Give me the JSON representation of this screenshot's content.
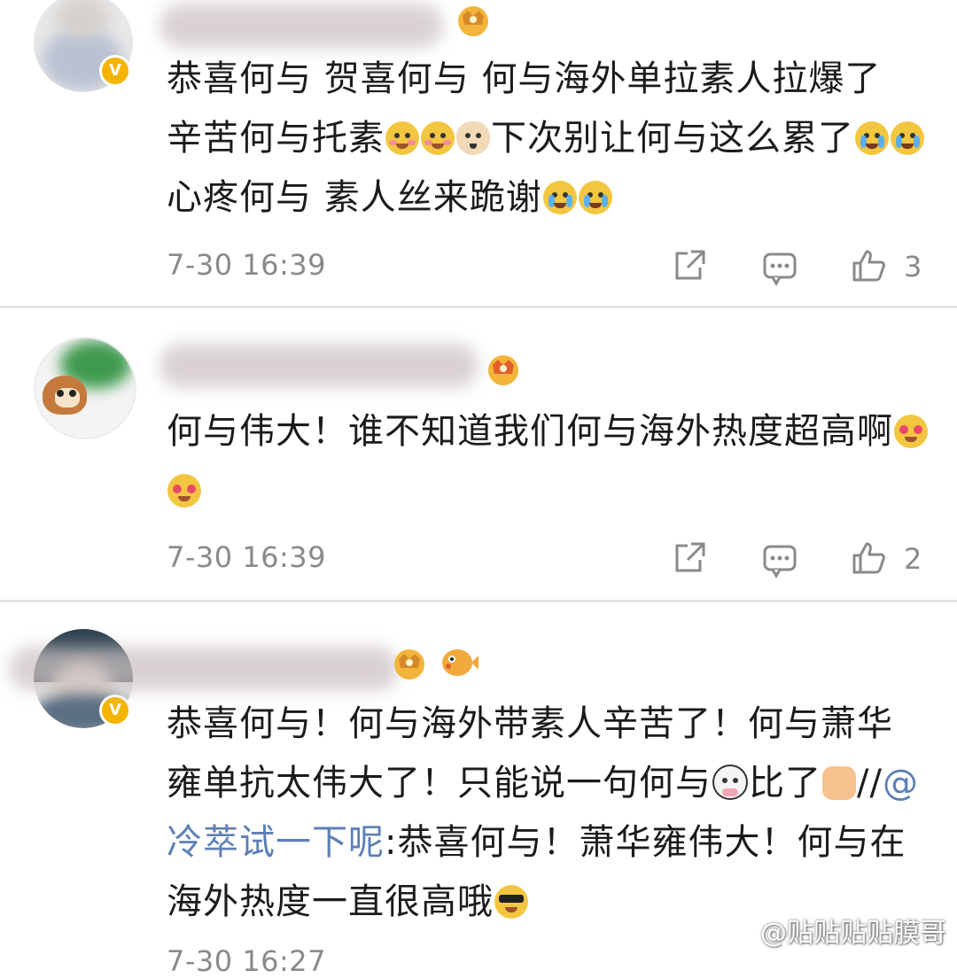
{
  "comments": [
    {
      "text_parts": [
        {
          "t": "text",
          "v": "恭喜何与 贺喜何与 何与海外单拉素人拉爆了 辛苦何与托素"
        },
        {
          "t": "emoji",
          "icon": "blush-face-icon"
        },
        {
          "t": "emoji",
          "icon": "blush-face-icon"
        },
        {
          "t": "emoji",
          "icon": "dog-face-icon"
        },
        {
          "t": "text",
          "v": "下次别让何与这么累了"
        },
        {
          "t": "emoji",
          "icon": "crying-face-icon"
        },
        {
          "t": "emoji",
          "icon": "crying-face-icon"
        },
        {
          "t": "text",
          "v": "心疼何与 素人丝来跪谢"
        },
        {
          "t": "emoji",
          "icon": "crying-face-icon"
        },
        {
          "t": "emoji",
          "icon": "crying-face-icon"
        }
      ],
      "time": "7-30 16:39",
      "likes": "3",
      "badge_icon": "crown-badge-icon",
      "verified": true
    },
    {
      "text_parts": [
        {
          "t": "text",
          "v": "何与伟大！谁不知道我们何与海外热度超高啊"
        },
        {
          "t": "emoji",
          "icon": "heart-eyes-face-icon"
        },
        {
          "t": "emoji",
          "icon": "heart-eyes-face-icon"
        }
      ],
      "time": "7-30 16:39",
      "likes": "2",
      "badge_icon": "crown-badge-icon",
      "verified": false
    },
    {
      "text_parts": [
        {
          "t": "text",
          "v": "恭喜何与！何与海外带素人辛苦了！何与萧华雍单抗太伟大了！只能说一句何与"
        },
        {
          "t": "emoji",
          "icon": "cow-face-icon"
        },
        {
          "t": "text",
          "v": "比了"
        },
        {
          "t": "emoji",
          "icon": "thumbs-up-icon"
        },
        {
          "t": "text",
          "v": "//"
        },
        {
          "t": "mention",
          "v": "@冷萃试一下呢"
        },
        {
          "t": "text",
          "v": ":恭喜何与！萧华雍伟大！何与在海外热度一直很高哦"
        },
        {
          "t": "emoji",
          "icon": "sunglasses-face-icon"
        }
      ],
      "time": "7-30 16:27",
      "badge_icon": "crown-badge-icon",
      "extra_badge_icon": "pufferfish-icon",
      "verified": true
    }
  ],
  "watermark": "@贴贴贴贴膜哥",
  "colors": {
    "text": "#1b1b1b",
    "meta": "#8a8a8a",
    "mention": "#5d7fb6",
    "verified": "#f5b400",
    "divider": "#e4e4e4"
  }
}
